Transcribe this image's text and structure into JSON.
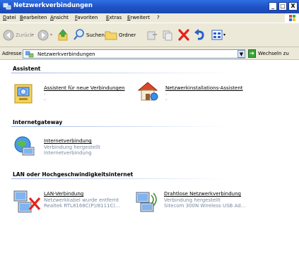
{
  "window": {
    "title": "Netzwerkverbindungen",
    "buttons": [
      "_",
      "□",
      "X"
    ]
  },
  "menu": {
    "items": [
      "Datei",
      "Bearbeiten",
      "Ansicht",
      "Favoriten",
      "Extras",
      "Erweitert",
      "?"
    ]
  },
  "toolbar": {
    "back_label": "Zurück",
    "search_label": "Suchen",
    "folders_label": "Ordner"
  },
  "address": {
    "label": "Adresse",
    "value": "Netzwerkverbindungen",
    "go_label": "Wechseln zu"
  },
  "groups": [
    {
      "header": "Assistent",
      "items": [
        {
          "name": "Assistent für neue Verbindungen",
          "lines": [
            "-",
            "-"
          ],
          "icon": "new-connection-wizard-icon"
        },
        {
          "name": "Netzwerkinstallations-Assistent",
          "lines": [
            "-",
            "-"
          ],
          "icon": "network-setup-wizard-icon"
        }
      ]
    },
    {
      "header": "Internetgateway",
      "items": [
        {
          "name": "Internetverbindung",
          "lines": [
            "Verbindung hergestellt",
            "Internetverbindung"
          ],
          "icon": "internet-connection-icon"
        }
      ]
    },
    {
      "header": "LAN oder Hochgeschwindigkeitsinternet",
      "items": [
        {
          "name": "LAN-Verbindung",
          "lines": [
            "Netzwerkkabel wurde entfernt",
            "Realtek RTL8168C(P)/8111C(..."
          ],
          "icon": "lan-disconnected-icon"
        },
        {
          "name": "Drahtlose Netzwerkverbindung",
          "lines": [
            "Verbindung hergestellt",
            "Sitecom 300N Wireless USB Ad..."
          ],
          "icon": "wireless-connection-icon"
        }
      ]
    }
  ]
}
